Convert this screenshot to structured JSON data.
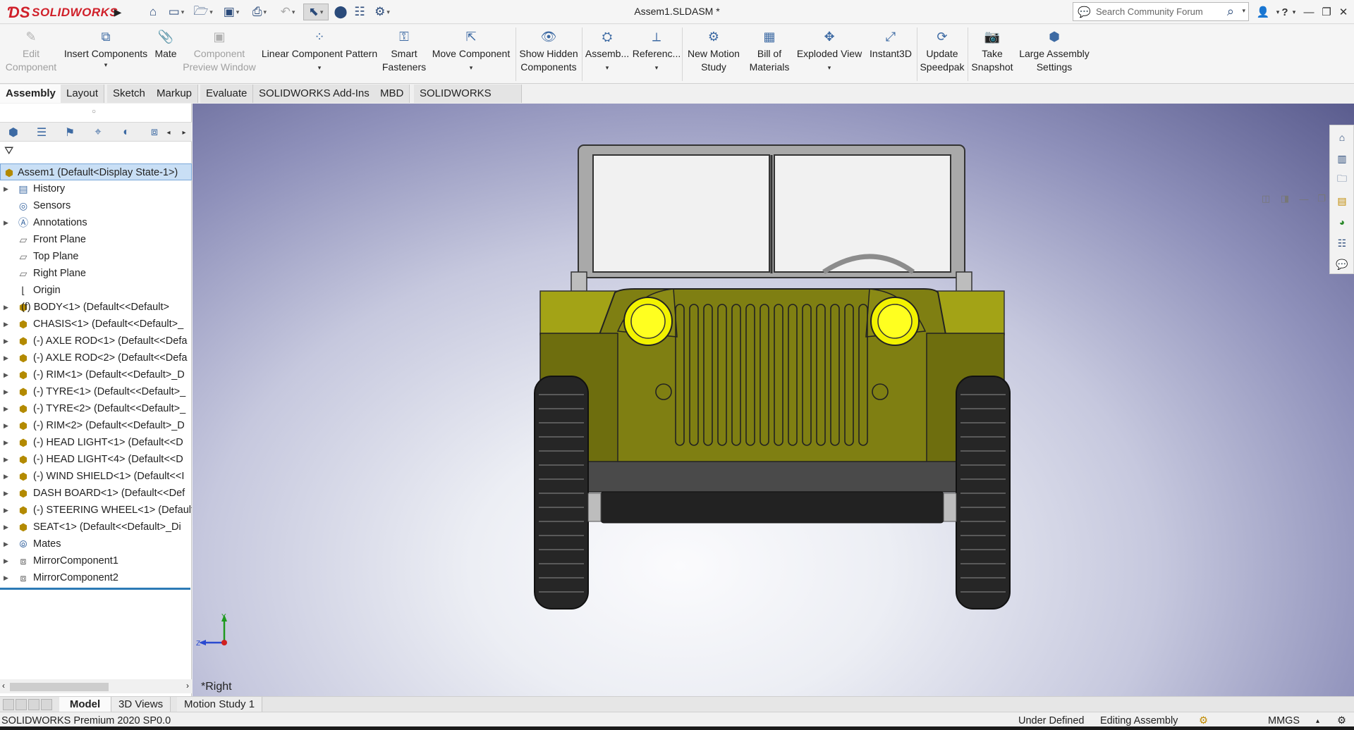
{
  "app": {
    "brand": "SOLIDWORKS",
    "document_title": "Assem1.SLDASM *",
    "search_placeholder": "Search Community Forum"
  },
  "quick_access": [
    {
      "name": "home-icon",
      "glyph": "⌂"
    },
    {
      "name": "new-file-icon",
      "glyph": "🗋"
    },
    {
      "name": "open-file-icon",
      "glyph": "📂"
    },
    {
      "name": "save-icon",
      "glyph": "💾"
    },
    {
      "name": "print-icon",
      "glyph": "🖶"
    },
    {
      "name": "undo-icon",
      "glyph": "↶"
    },
    {
      "name": "select-icon",
      "glyph": "⬚"
    },
    {
      "name": "rebuild-icon",
      "glyph": "🚦"
    },
    {
      "name": "file-properties-icon",
      "glyph": "☰"
    },
    {
      "name": "options-gear-icon",
      "glyph": "⚙"
    }
  ],
  "ribbon": {
    "buttons": [
      {
        "id": "edit-component",
        "label": "Edit Component",
        "disabled": true,
        "dropdown": false
      },
      {
        "id": "insert-components",
        "label": "Insert Components",
        "disabled": false,
        "dropdown": true
      },
      {
        "id": "mate",
        "label": "Mate",
        "disabled": false,
        "dropdown": false
      },
      {
        "id": "component-preview-window",
        "label": "Component Preview Window",
        "disabled": true,
        "dropdown": false
      },
      {
        "id": "linear-component-pattern",
        "label": "Linear Component Pattern",
        "disabled": false,
        "dropdown": true
      },
      {
        "id": "smart-fasteners",
        "label": "Smart Fasteners",
        "disabled": false,
        "dropdown": false
      },
      {
        "id": "move-component",
        "label": "Move Component",
        "disabled": false,
        "dropdown": true
      },
      {
        "id": "show-hidden-components",
        "label": "Show Hidden Components",
        "disabled": false,
        "dropdown": false
      },
      {
        "id": "assembly-features",
        "label": "Assemb...",
        "disabled": false,
        "dropdown": true
      },
      {
        "id": "reference-geometry",
        "label": "Referenc...",
        "disabled": false,
        "dropdown": true
      },
      {
        "id": "new-motion-study",
        "label": "New Motion Study",
        "disabled": false,
        "dropdown": false
      },
      {
        "id": "bill-of-materials",
        "label": "Bill of Materials",
        "disabled": false,
        "dropdown": false
      },
      {
        "id": "exploded-view",
        "label": "Exploded View",
        "disabled": false,
        "dropdown": true
      },
      {
        "id": "instant3d",
        "label": "Instant3D",
        "disabled": false,
        "dropdown": false
      },
      {
        "id": "update-speedpak",
        "label": "Update Speedpak",
        "disabled": false,
        "dropdown": false
      },
      {
        "id": "take-snapshot",
        "label": "Take Snapshot",
        "disabled": false,
        "dropdown": false
      },
      {
        "id": "large-assembly-settings",
        "label": "Large Assembly Settings",
        "disabled": false,
        "dropdown": false
      }
    ]
  },
  "command_tabs": [
    "Assembly",
    "Layout",
    "Sketch",
    "Markup",
    "Evaluate",
    "SOLIDWORKS Add-Ins",
    "MBD",
    "SOLIDWORKS CAM"
  ],
  "active_command_tab": "Assembly",
  "feature_tree": {
    "root": "Assem1  (Default<Display State-1>)",
    "items": [
      {
        "label": "History",
        "expandable": true,
        "icon": "history-folder-icon"
      },
      {
        "label": "Sensors",
        "expandable": false,
        "icon": "sensors-folder-icon"
      },
      {
        "label": "Annotations",
        "expandable": true,
        "icon": "annotations-folder-icon"
      },
      {
        "label": "Front Plane",
        "expandable": false,
        "icon": "plane-icon"
      },
      {
        "label": "Top Plane",
        "expandable": false,
        "icon": "plane-icon"
      },
      {
        "label": "Right Plane",
        "expandable": false,
        "icon": "plane-icon"
      },
      {
        "label": "Origin",
        "expandable": false,
        "icon": "origin-icon"
      },
      {
        "label": "(f) BODY<1> (Default<<Default>",
        "expandable": true,
        "icon": "part-icon"
      },
      {
        "label": "CHASIS<1> (Default<<Default>_",
        "expandable": true,
        "icon": "part-icon"
      },
      {
        "label": "(-) AXLE ROD<1> (Default<<Defa",
        "expandable": true,
        "icon": "part-icon"
      },
      {
        "label": "(-) AXLE ROD<2> (Default<<Defa",
        "expandable": true,
        "icon": "part-icon"
      },
      {
        "label": "(-) RIM<1> (Default<<Default>_D",
        "expandable": true,
        "icon": "part-icon"
      },
      {
        "label": "(-) TYRE<1> (Default<<Default>_",
        "expandable": true,
        "icon": "part-icon"
      },
      {
        "label": "(-) TYRE<2> (Default<<Default>_",
        "expandable": true,
        "icon": "part-icon"
      },
      {
        "label": "(-) RIM<2> (Default<<Default>_D",
        "expandable": true,
        "icon": "part-icon"
      },
      {
        "label": "(-) HEAD LIGHT<1> (Default<<D",
        "expandable": true,
        "icon": "part-icon"
      },
      {
        "label": "(-) HEAD LIGHT<4> (Default<<D",
        "expandable": true,
        "icon": "part-icon"
      },
      {
        "label": "(-) WIND SHIELD<1> (Default<<I",
        "expandable": true,
        "icon": "part-icon"
      },
      {
        "label": "DASH BOARD<1> (Default<<Def",
        "expandable": true,
        "icon": "part-icon"
      },
      {
        "label": "(-) STEERING WHEEL<1> (Default",
        "expandable": true,
        "icon": "part-icon"
      },
      {
        "label": "SEAT<1> (Default<<Default>_Di",
        "expandable": true,
        "icon": "part-icon"
      },
      {
        "label": "Mates",
        "expandable": true,
        "icon": "mates-icon"
      },
      {
        "label": "MirrorComponent1",
        "expandable": true,
        "icon": "mirror-component-icon"
      },
      {
        "label": "MirrorComponent2",
        "expandable": true,
        "icon": "mirror-component-icon"
      }
    ]
  },
  "viewport": {
    "view_name": "*Right",
    "triad": {
      "y_label": "Y",
      "z_label": "Z"
    }
  },
  "bottom_tabs": [
    "Model",
    "3D Views",
    "Motion Study 1"
  ],
  "active_bottom_tab": "Model",
  "status": {
    "product": "SOLIDWORKS Premium 2020 SP0.0",
    "definition": "Under Defined",
    "mode": "Editing Assembly",
    "units": "MMGS"
  },
  "colors": {
    "body": "#7f7f12",
    "headlight": "#f2f200",
    "frame": "#a9a9a9",
    "tyre": "#262626",
    "brand": "#d0202a",
    "selection": "#c9dff5"
  }
}
